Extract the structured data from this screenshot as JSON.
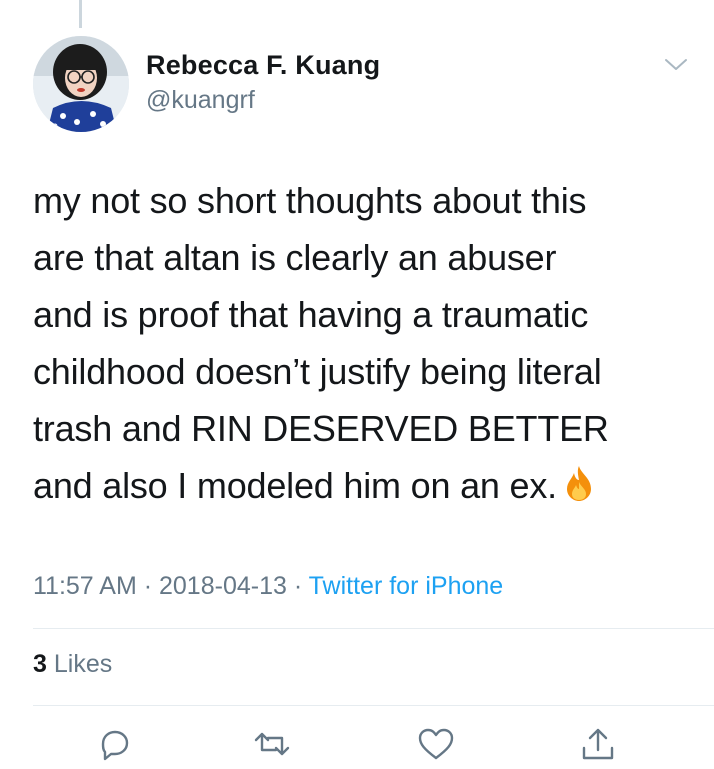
{
  "author": {
    "name": "Rebecca F. Kuang",
    "handle": "@kuangrf"
  },
  "tweet": {
    "lines": [
      "my not so short thoughts about this",
      "are that altan is clearly an abuser",
      "and is proof that having a traumatic",
      "childhood doesn’t justify being literal",
      "trash and RIN DESERVED BETTER",
      "and also I modeled him on an ex."
    ],
    "emoji": "fire-emoji"
  },
  "meta": {
    "time": "11:57 AM",
    "separator": " · ",
    "date": "2018-04-13",
    "source": "Twitter for iPhone"
  },
  "stats": {
    "likes_count": "3",
    "likes_label": "Likes"
  },
  "icons": {
    "menu": "chevron-down-icon",
    "reply": "reply-icon",
    "retweet": "retweet-icon",
    "like": "heart-icon",
    "share": "share-icon"
  },
  "colors": {
    "text": "#14171a",
    "secondary": "#657786",
    "link": "#1da1f2",
    "divider": "#e6ecf0"
  }
}
